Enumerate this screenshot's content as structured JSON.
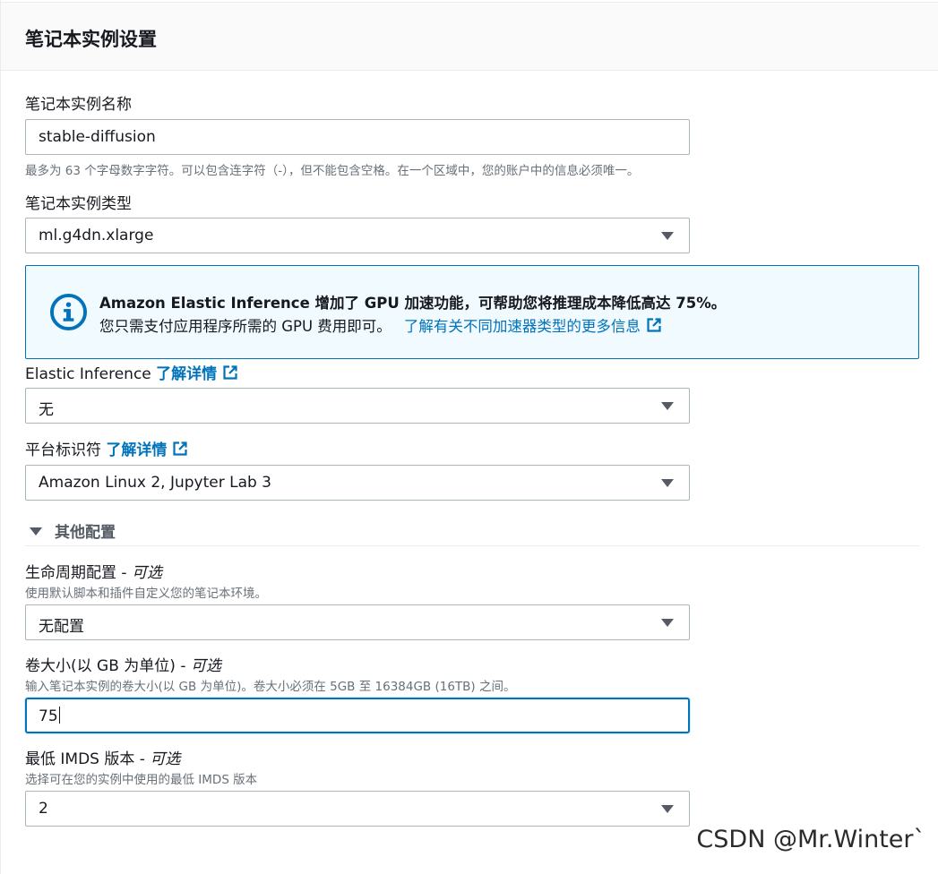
{
  "header": {
    "title": "笔记本实例设置"
  },
  "instance_name": {
    "label": "笔记本实例名称",
    "value": "stable-diffusion",
    "hint": "最多为 63 个字母数字字符。可以包含连字符（-），但不能包含空格。在一个区域中，您的账户中的信息必须唯一。"
  },
  "instance_type": {
    "label": "笔记本实例类型",
    "value": "ml.g4dn.xlarge"
  },
  "info_alert": {
    "headline": "Amazon Elastic Inference 增加了 GPU 加速功能，可帮助您将推理成本降低高达 75%。",
    "body": "您只需支付应用程序所需的 GPU 费用即可。",
    "link": "了解有关不同加速器类型的更多信息"
  },
  "elastic_inference": {
    "label": "Elastic Inference",
    "link": "了解详情",
    "value": "无"
  },
  "platform": {
    "label": "平台标识符",
    "link": "了解详情",
    "value": "Amazon Linux 2, Jupyter Lab 3"
  },
  "additional_config": {
    "title": "其他配置"
  },
  "lifecycle": {
    "label": "生命周期配置",
    "optional": "可选",
    "hint": "使用默认脚本和插件自定义您的笔记本环境。",
    "value": "无配置"
  },
  "volume": {
    "label": "卷大小(以 GB 为单位)",
    "optional": "可选",
    "hint": "输入笔记本实例的卷大小(以 GB 为单位)。卷大小必须在 5GB 至 16384GB (16TB) 之间。",
    "value": "75"
  },
  "imds": {
    "label": "最低 IMDS 版本",
    "optional": "可选",
    "hint": "选择可在您的实例中使用的最低 IMDS 版本",
    "value": "2"
  },
  "watermark": "CSDN @Mr.Winter`",
  "icons": {
    "info": "info-circle-icon",
    "external": "external-link-icon",
    "dropdown": "caret-down-icon"
  },
  "colors": {
    "accent": "#0073bb",
    "info_bg": "#f1faff",
    "header_bg": "#fafafa"
  }
}
